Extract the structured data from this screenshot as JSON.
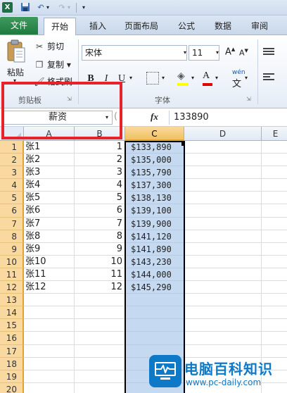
{
  "quick_access": {
    "app_icon": "X",
    "icons": [
      "excel-logo-icon",
      "save-icon",
      "undo-icon",
      "redo-icon",
      "customize-arrow-icon"
    ]
  },
  "tabs": {
    "file": "文件",
    "home": "开始",
    "insert": "插入",
    "page_layout": "页面布局",
    "formulas": "公式",
    "data": "数据",
    "review": "审阅"
  },
  "ribbon": {
    "clipboard": {
      "paste": "粘贴",
      "cut": "剪切",
      "copy": "复制",
      "copy_arrow": "▾",
      "format_painter": "格式刷",
      "group_label": "剪贴板"
    },
    "font": {
      "font_name": "宋体",
      "font_size": "11",
      "grow": "A",
      "shrink": "A",
      "bold": "B",
      "italic": "I",
      "underline": "U",
      "font_color_letter": "A",
      "phonetic": "wén",
      "group_label": "字体",
      "fill_color": "#ffff00",
      "text_color": "#e00000"
    }
  },
  "formula_bar": {
    "name_box": "薪资",
    "fx": "fx",
    "value": "133890"
  },
  "columns": [
    "A",
    "B",
    "C",
    "D",
    "E"
  ],
  "selected_column": "C",
  "rows": [
    {
      "num": "1",
      "a": "张1",
      "b": "1",
      "c": "$133,890"
    },
    {
      "num": "2",
      "a": "张2",
      "b": "2",
      "c": "$135,000"
    },
    {
      "num": "3",
      "a": "张3",
      "b": "3",
      "c": "$135,790"
    },
    {
      "num": "4",
      "a": "张4",
      "b": "4",
      "c": "$137,300"
    },
    {
      "num": "5",
      "a": "张5",
      "b": "5",
      "c": "$138,130"
    },
    {
      "num": "6",
      "a": "张6",
      "b": "6",
      "c": "$139,100"
    },
    {
      "num": "7",
      "a": "张7",
      "b": "7",
      "c": "$139,900"
    },
    {
      "num": "8",
      "a": "张8",
      "b": "8",
      "c": "$141,120"
    },
    {
      "num": "9",
      "a": "张9",
      "b": "9",
      "c": "$141,890"
    },
    {
      "num": "10",
      "a": "张10",
      "b": "10",
      "c": "$143,230"
    },
    {
      "num": "11",
      "a": "张11",
      "b": "11",
      "c": "$144,000"
    },
    {
      "num": "12",
      "a": "张12",
      "b": "12",
      "c": "$145,290"
    },
    {
      "num": "13",
      "a": "",
      "b": "",
      "c": ""
    },
    {
      "num": "14",
      "a": "",
      "b": "",
      "c": ""
    },
    {
      "num": "15",
      "a": "",
      "b": "",
      "c": ""
    },
    {
      "num": "16",
      "a": "",
      "b": "",
      "c": ""
    },
    {
      "num": "17",
      "a": "",
      "b": "",
      "c": ""
    },
    {
      "num": "18",
      "a": "",
      "b": "",
      "c": ""
    },
    {
      "num": "19",
      "a": "",
      "b": "",
      "c": ""
    },
    {
      "num": "20",
      "a": "",
      "b": "",
      "c": ""
    }
  ],
  "watermark": {
    "title": "电脑百科知识",
    "url": "www.pc-daily.com",
    "color": "#0e79c7"
  },
  "colors": {
    "file_tab": "#1e7a3f",
    "selection_fill": "#c5d9f1",
    "highlight_border": "#e8222a",
    "header_selected": "#f1c15f"
  }
}
